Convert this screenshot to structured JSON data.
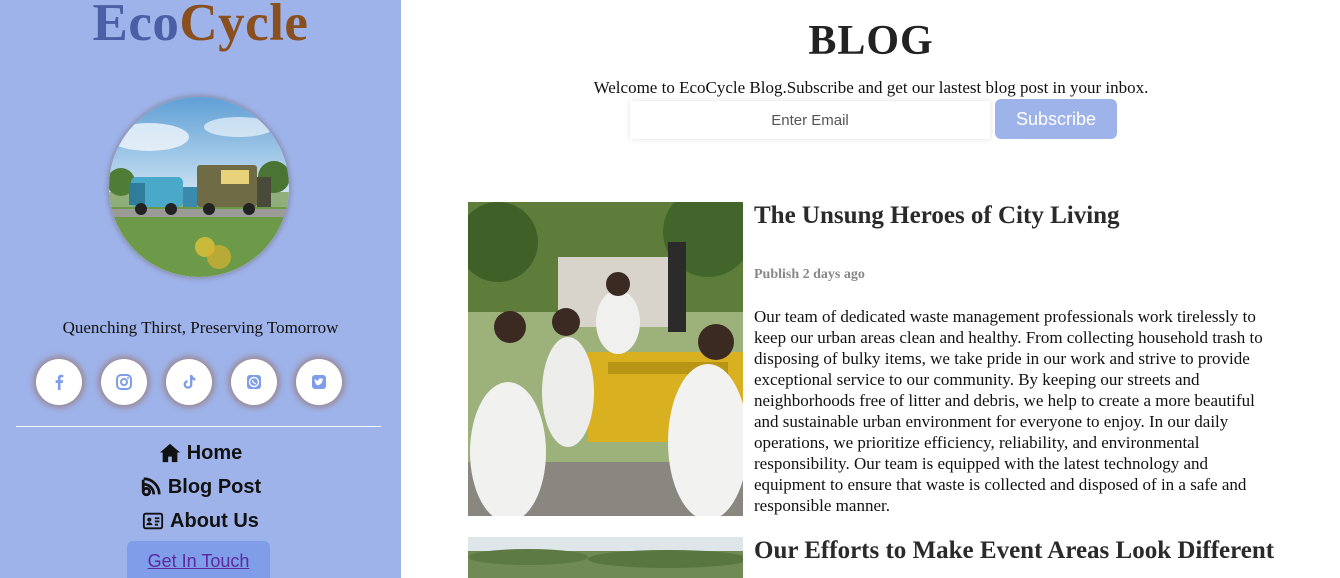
{
  "sidebar": {
    "logo_part1": "Eco",
    "logo_part2": "Cycle",
    "tagline": "Quenching Thirst, Preserving Tomorrow",
    "socials": [
      "facebook-icon",
      "instagram-icon",
      "tiktok-icon",
      "whatsapp-icon",
      "twitter-icon"
    ],
    "nav": [
      {
        "label": "Home",
        "icon": "home-icon"
      },
      {
        "label": "Blog Post",
        "icon": "blog-icon"
      },
      {
        "label": "About Us",
        "icon": "id-card-icon"
      }
    ],
    "contact_label": "Get In Touch"
  },
  "main": {
    "title": "BLOG",
    "welcome": "Welcome to EcoCycle Blog.Subscribe and get our lastest blog post in your inbox.",
    "email_placeholder": "Enter Email",
    "subscribe_label": "Subscribe",
    "posts": [
      {
        "title": "The Unsung Heroes of City Living",
        "meta": "Publish 2 days ago",
        "body": "Our team of dedicated waste management professionals work tirelessly to keep our urban areas clean and healthy. From collecting household trash to disposing of bulky items, we take pride in our work and strive to provide exceptional service to our community. By keeping our streets and neighborhoods free of litter and debris, we help to create a more beautiful and sustainable urban environment for everyone to enjoy. In our daily operations, we prioritize efficiency, reliability, and environmental responsibility. Our team is equipped with the latest technology and equipment to ensure that waste is collected and disposed of in a safe and responsible manner."
      },
      {
        "title": "Our Efforts to Make Event Areas Look Different"
      }
    ]
  },
  "colors": {
    "sidebar_bg": "#9eb3ea",
    "logo_eco": "#4a5fa6",
    "logo_cycle": "#8a4f1f",
    "subscribe_bg": "#9eb3ea",
    "contact_bg": "#7f9de8",
    "social_icon": "#7f9de8"
  }
}
